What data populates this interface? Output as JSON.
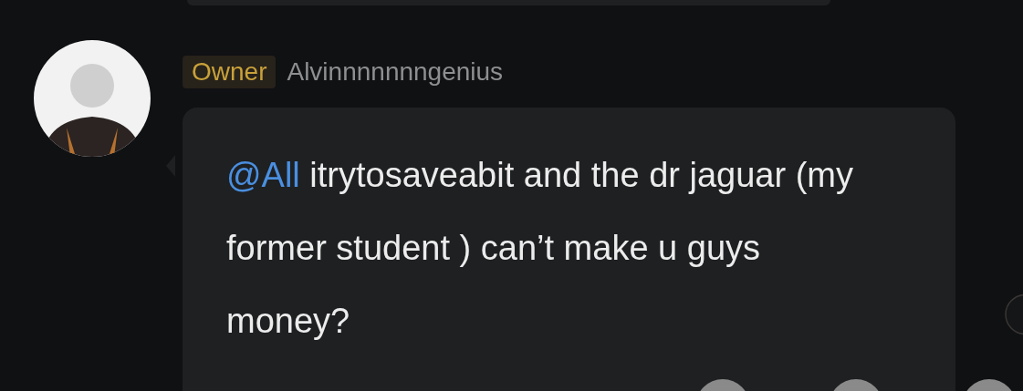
{
  "message": {
    "role_tag": "Owner",
    "sender": "Alvinnnnnnngenius",
    "mention": "@All",
    "text": "itrytosaveabit and the dr jaguar (my former student ) can’t make u guys money?"
  }
}
